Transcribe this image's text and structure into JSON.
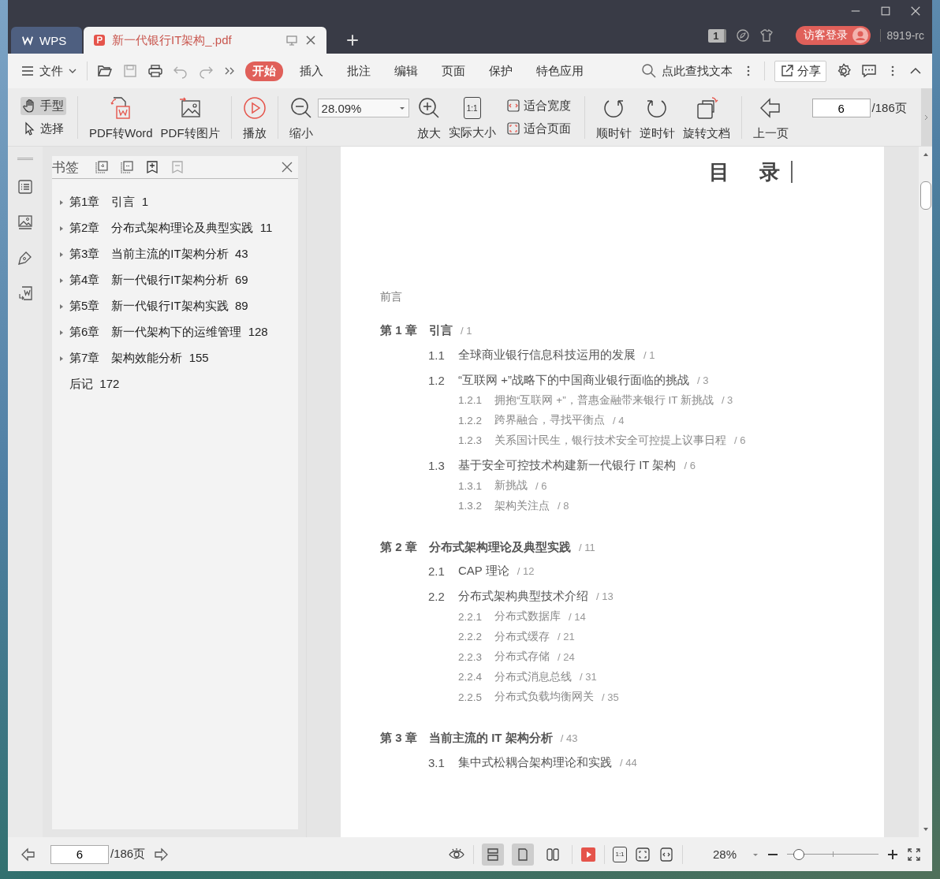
{
  "tabs": [
    {
      "label": "WPS",
      "kind": "home",
      "selected": false
    },
    {
      "label": "新一代银行IT架构_.pdf",
      "kind": "document",
      "selected": true
    }
  ],
  "title_bar": {
    "badge": "1",
    "login": "访客登录",
    "user": "8919-rc"
  },
  "menu": {
    "file": "文件",
    "items": [
      {
        "label": "开始",
        "selected": true
      },
      {
        "label": "插入",
        "selected": false
      },
      {
        "label": "批注",
        "selected": false
      },
      {
        "label": "编辑",
        "selected": false
      },
      {
        "label": "页面",
        "selected": false
      },
      {
        "label": "保护",
        "selected": false
      },
      {
        "label": "特色应用",
        "selected": false
      }
    ],
    "search": "点此查找文本",
    "share": "分享"
  },
  "toolbar": {
    "hand": {
      "label": "手型",
      "selected": true
    },
    "select": {
      "label": "选择",
      "selected": false
    },
    "to_word": "PDF转Word",
    "to_image": "PDF转图片",
    "play": "播放",
    "zoom_out": "缩小",
    "zoom": "28.09%",
    "zoom_in": "放大",
    "actual_size": {
      "label": "实际大小",
      "icon_text": "1:1"
    },
    "fit_width": "适合宽度",
    "fit_page": "适合页面",
    "clockwise": "顺时针",
    "counterclockwise": "逆时针",
    "rotate": "旋转文档",
    "prev": "上一页",
    "page": "6",
    "total": "/186页"
  },
  "bookmarks": {
    "title": "书签",
    "items": [
      {
        "label": "第1章　引言  1",
        "expandable": true
      },
      {
        "label": "第2章　分布式架构理论及典型实践  11",
        "expandable": true
      },
      {
        "label": "第3章　当前主流的IT架构分析  43",
        "expandable": true
      },
      {
        "label": "第4章　新一代银行IT架构分析  69",
        "expandable": true
      },
      {
        "label": "第5章　新一代银行IT架构实践  89",
        "expandable": true
      },
      {
        "label": "第6章　新一代架构下的运维管理  128",
        "expandable": true
      },
      {
        "label": "第7章　架构效能分析  155",
        "expandable": true
      },
      {
        "label": "后记  172",
        "expandable": false
      }
    ]
  },
  "contents": {
    "heading": "目　录",
    "preface": "前言",
    "chapters": [
      {
        "number": "第 1 章",
        "title": "引言",
        "page": "/ 1",
        "children": [
          {
            "number": "1.1",
            "title": "全球商业银行信息科技运用的发展",
            "page": "/ 1"
          },
          {
            "number": "1.2",
            "title": "“互联网 +”战略下的中国商业银行面临的挑战",
            "page": "/ 3",
            "children": [
              {
                "number": "1.2.1",
                "title": "拥抱“互联网 +”，普惠金融带来银行 IT 新挑战",
                "page": "/ 3"
              },
              {
                "number": "1.2.2",
                "title": "跨界融合，寻找平衡点",
                "page": "/ 4"
              },
              {
                "number": "1.2.3",
                "title": "关系国计民生，银行技术安全可控提上议事日程",
                "page": "/ 6"
              }
            ]
          },
          {
            "number": "1.3",
            "title": "基于安全可控技术构建新一代银行 IT 架构",
            "page": "/ 6",
            "children": [
              {
                "number": "1.3.1",
                "title": "新挑战",
                "page": "/ 6"
              },
              {
                "number": "1.3.2",
                "title": "架构关注点",
                "page": "/ 8"
              }
            ]
          }
        ]
      },
      {
        "number": "第 2 章",
        "title": "分布式架构理论及典型实践",
        "page": "/ 11",
        "children": [
          {
            "number": "2.1",
            "title": "CAP 理论",
            "page": "/ 12"
          },
          {
            "number": "2.2",
            "title": "分布式架构典型技术介绍",
            "page": "/ 13",
            "children": [
              {
                "number": "2.2.1",
                "title": "分布式数据库",
                "page": "/ 14"
              },
              {
                "number": "2.2.2",
                "title": "分布式缓存",
                "page": "/ 21"
              },
              {
                "number": "2.2.3",
                "title": "分布式存储",
                "page": "/ 24"
              },
              {
                "number": "2.2.4",
                "title": "分布式消息总线",
                "page": "/ 31"
              },
              {
                "number": "2.2.5",
                "title": "分布式负载均衡网关",
                "page": "/ 35"
              }
            ]
          }
        ]
      },
      {
        "number": "第 3 章",
        "title": "当前主流的 IT 架构分析",
        "page": "/ 43",
        "children": [
          {
            "number": "3.1",
            "title": "集中式松耦合架构理论和实践",
            "page": "/ 44"
          }
        ]
      }
    ]
  },
  "status_bar": {
    "page": "6",
    "total": "/186页",
    "views": [
      {
        "selected": true
      },
      {
        "selected": true
      },
      {
        "selected": false
      }
    ],
    "actual_size_icon_text": "1:1",
    "zoom": "28%",
    "level": 0.13
  }
}
